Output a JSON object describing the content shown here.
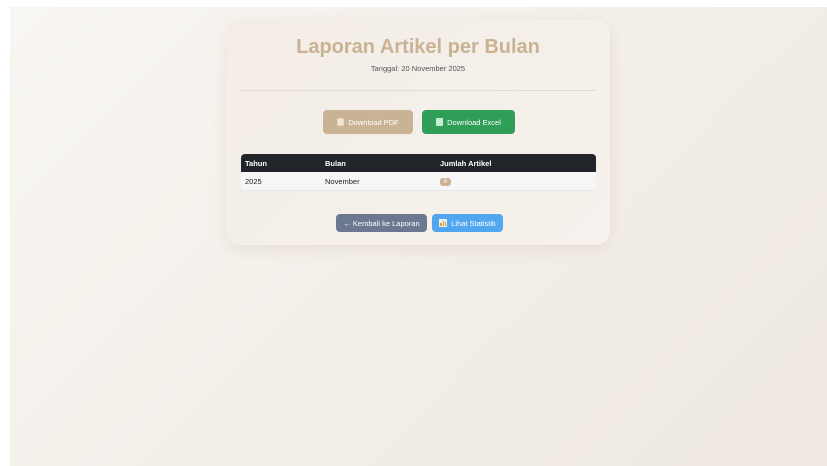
{
  "header": {
    "title": "Laporan Artikel per Bulan",
    "date": "Tanggal: 20 November 2025"
  },
  "actions": {
    "pdf_label": "Download PDF",
    "excel_label": "Download Excel"
  },
  "table": {
    "headers": [
      "Tahun",
      "Bulan",
      "Jumlah Artikel"
    ],
    "rows": [
      {
        "tahun": "2025",
        "bulan": "November",
        "jumlah": "6"
      }
    ]
  },
  "nav": {
    "back_label": "← Kembali ke Laporan",
    "stat_label": "Lihat Statistik"
  },
  "colors": {
    "accent": "#c9b394",
    "excel": "#2f9e58",
    "back": "#6b7890",
    "stat": "#50a7f0",
    "table_header": "#212428"
  },
  "icons": {
    "pdf": "document-icon",
    "excel": "spreadsheet-icon",
    "stat": "bar-chart-icon"
  }
}
